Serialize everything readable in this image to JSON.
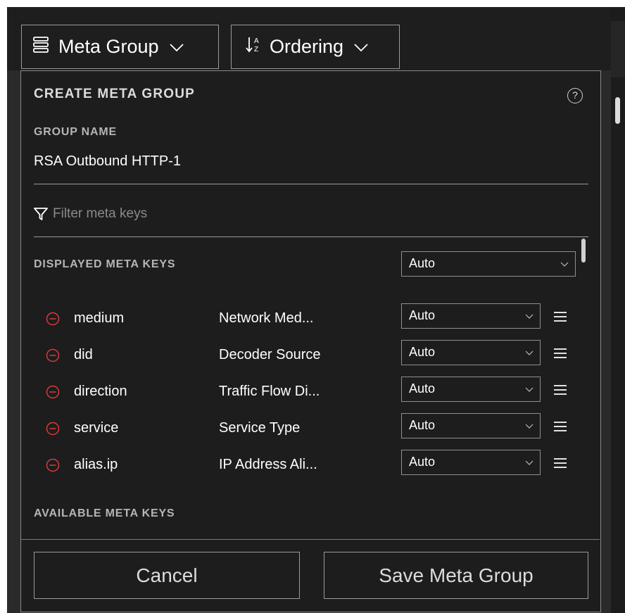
{
  "toolbar": {
    "meta_group_label": "Meta Group",
    "ordering_label": "Ordering"
  },
  "panel": {
    "title": "CREATE META GROUP",
    "help_symbol": "?",
    "group_name_label": "GROUP NAME",
    "group_name_value": "RSA Outbound HTTP-1",
    "filter_placeholder": "Filter meta keys",
    "displayed_label": "DISPLAYED META KEYS",
    "displayed_global_select": "Auto",
    "rows": [
      {
        "key": "medium",
        "desc": "Network Med...",
        "select": "Auto"
      },
      {
        "key": "did",
        "desc": "Decoder Source",
        "select": "Auto"
      },
      {
        "key": "direction",
        "desc": "Traffic Flow Di...",
        "select": "Auto"
      },
      {
        "key": "service",
        "desc": "Service Type",
        "select": "Auto"
      },
      {
        "key": "alias.ip",
        "desc": "IP Address Ali...",
        "select": "Auto"
      }
    ],
    "available_label": "AVAILABLE META KEYS",
    "cancel_label": "Cancel",
    "save_label": "Save Meta Group"
  },
  "colors": {
    "panel_bg": "#1d1d1d",
    "remove_icon": "#d9393c",
    "border": "#9a9a9a"
  },
  "icons": {
    "meta_group": "list-icon",
    "ordering": "sort-alpha-icon",
    "filter": "filter-icon",
    "remove": "minus-circle-icon",
    "drag": "drag-handle-icon",
    "help": "help-circle-icon"
  }
}
